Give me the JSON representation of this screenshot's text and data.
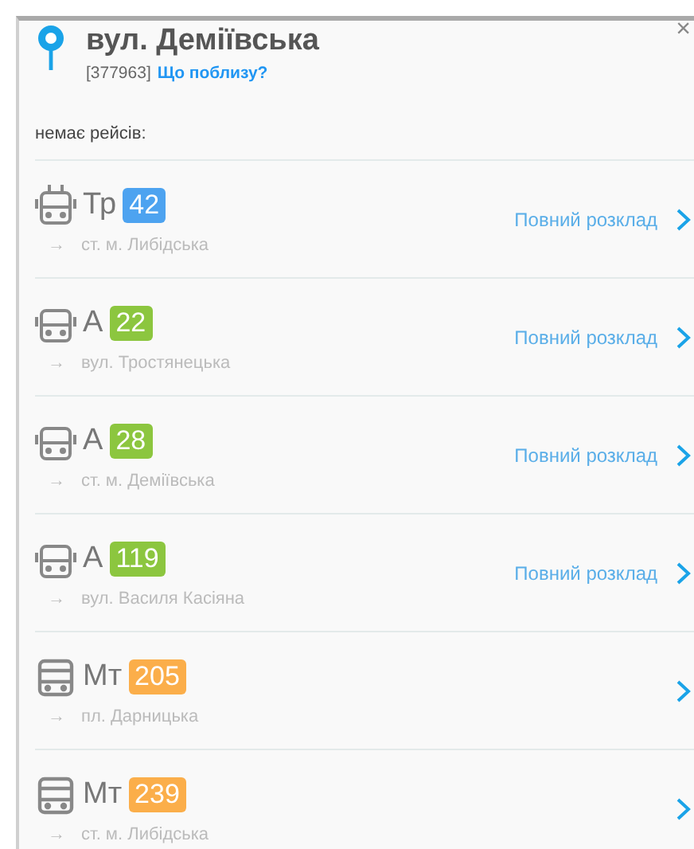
{
  "stop": {
    "title": "вул. Деміївська",
    "code": "[377963]",
    "nearby_link": "Що поблизу?",
    "close": "×"
  },
  "notice": "немає рейсів:",
  "routes": [
    {
      "kind": "trolleybus",
      "type": "Тр",
      "number": "42",
      "color": "#4da3f0",
      "direction_arrow": "→",
      "direction": "ст. м. Либідська",
      "schedule_link": "Повний розклад"
    },
    {
      "kind": "bus",
      "type": "А",
      "number": "22",
      "color": "#8cc63f",
      "direction_arrow": "→",
      "direction": "вул. Тростянецька",
      "schedule_link": "Повний розклад"
    },
    {
      "kind": "bus",
      "type": "А",
      "number": "28",
      "color": "#8cc63f",
      "direction_arrow": "→",
      "direction": "ст. м. Деміївська",
      "schedule_link": "Повний розклад"
    },
    {
      "kind": "bus",
      "type": "А",
      "number": "119",
      "color": "#8cc63f",
      "direction_arrow": "→",
      "direction": "вул. Василя Касіяна",
      "schedule_link": "Повний розклад"
    },
    {
      "kind": "minibus",
      "type": "Мт",
      "number": "205",
      "color": "#fbae4a",
      "direction_arrow": "→",
      "direction": "пл. Дарницька"
    },
    {
      "kind": "minibus",
      "type": "Мт",
      "number": "239",
      "color": "#fbae4a",
      "direction_arrow": "→",
      "direction": "ст. м. Либідська"
    }
  ]
}
